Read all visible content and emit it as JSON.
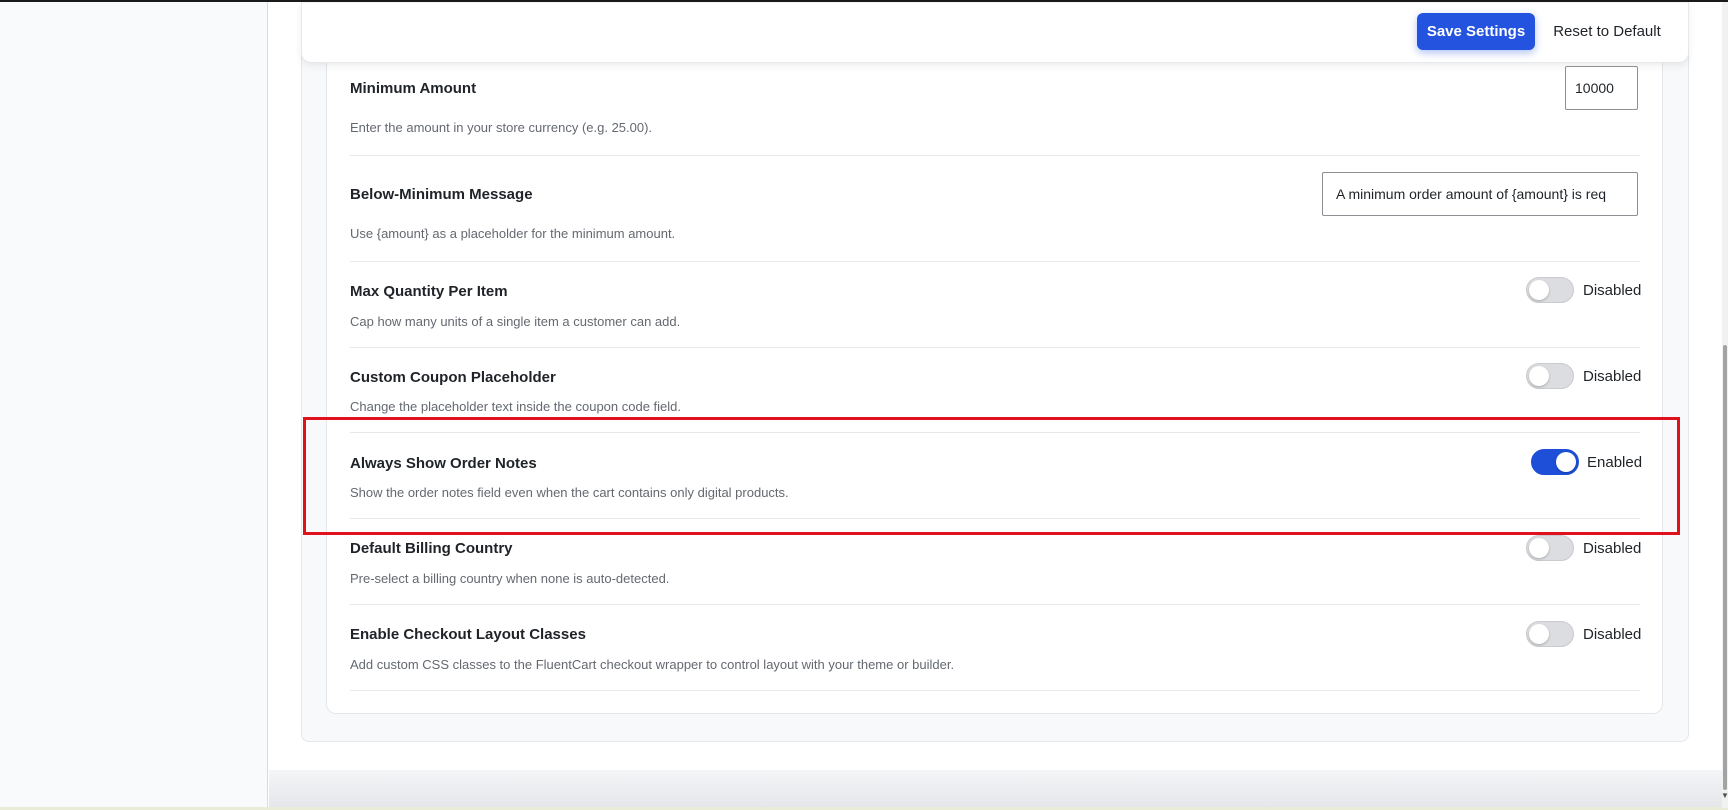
{
  "header": {
    "save_label": "Save Settings",
    "reset_label": "Reset to Default"
  },
  "settings": [
    {
      "label": "Minimum Amount",
      "description": "Enter the amount in your store currency (e.g. 25.00).",
      "control": "number",
      "value": "10000"
    },
    {
      "label": "Below-Minimum Message",
      "description": "Use {amount} as a placeholder for the minimum amount.",
      "control": "text",
      "value": "A minimum order amount of {amount} is req"
    },
    {
      "label": "Max Quantity Per Item",
      "description": "Cap how many units of a single item a customer can add.",
      "control": "toggle",
      "state": "Disabled"
    },
    {
      "label": "Custom Coupon Placeholder",
      "description": "Change the placeholder text inside the coupon code field.",
      "control": "toggle",
      "state": "Disabled"
    },
    {
      "label": "Always Show Order Notes",
      "description": "Show the order notes field even when the cart contains only digital products.",
      "control": "toggle",
      "state": "Enabled"
    },
    {
      "label": "Default Billing Country",
      "description": "Pre-select a billing country when none is auto-detected.",
      "control": "toggle",
      "state": "Disabled"
    },
    {
      "label": "Enable Checkout Layout Classes",
      "description": "Add custom CSS classes to the FluentCart checkout wrapper to control layout with your theme or builder.",
      "control": "toggle",
      "state": "Disabled"
    }
  ],
  "colors": {
    "primary": "#2453e0",
    "toggle_on": "#1d4fd8",
    "toggle_off": "#dcdde0",
    "highlight": "#e0101d"
  }
}
